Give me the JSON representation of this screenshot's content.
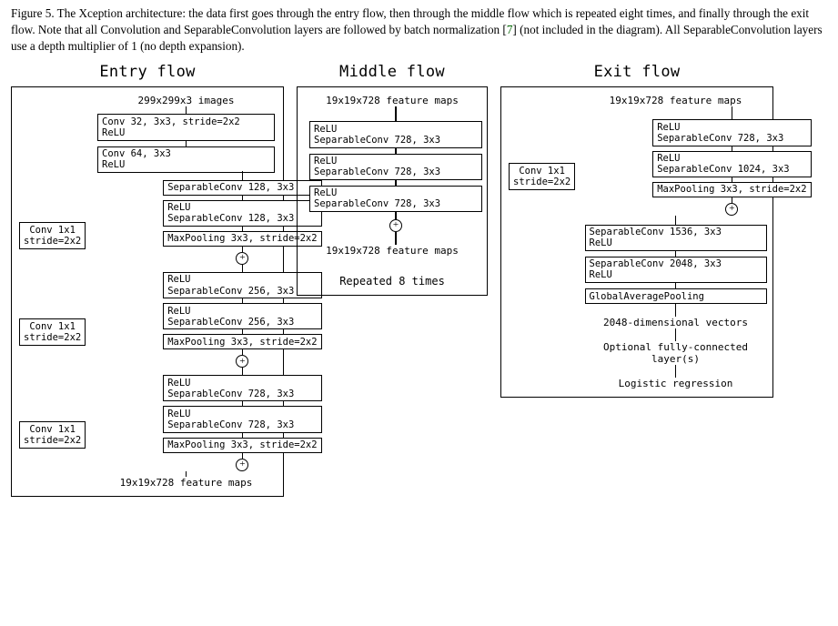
{
  "caption": {
    "prefix": "Figure 5. The Xception architecture: the data first goes through the entry flow, then through the middle flow which is repeated eight times, and finally through the exit flow. Note that all Convolution and SeparableConvolution layers are followed by batch normalization [",
    "cite": "7",
    "suffix": "] (not included in the diagram). All SeparableConvolution layers use a depth multiplier of 1 (no depth expansion)."
  },
  "entry": {
    "title": "Entry flow",
    "input": "299x299x3 images",
    "stem": [
      "Conv 32, 3x3, stride=2x2\nReLU",
      "Conv 64, 3x3\nReLU"
    ],
    "blocks": [
      {
        "side": "Conv 1x1\nstride=2x2",
        "layers": [
          "SeparableConv 128, 3x3",
          "ReLU\nSeparableConv 128, 3x3",
          "MaxPooling 3x3, stride=2x2"
        ]
      },
      {
        "side": "Conv 1x1\nstride=2x2",
        "layers": [
          "ReLU\nSeparableConv 256, 3x3",
          "ReLU\nSeparableConv 256, 3x3",
          "MaxPooling 3x3, stride=2x2"
        ]
      },
      {
        "side": "Conv 1x1\nstride=2x2",
        "layers": [
          "ReLU\nSeparableConv 728, 3x3",
          "ReLU\nSeparableConv 728, 3x3",
          "MaxPooling 3x3, stride=2x2"
        ]
      }
    ],
    "output": "19x19x728 feature maps"
  },
  "middle": {
    "title": "Middle flow",
    "input": "19x19x728 feature maps",
    "layers": [
      "ReLU\nSeparableConv 728, 3x3",
      "ReLU\nSeparableConv 728, 3x3",
      "ReLU\nSeparableConv 728, 3x3"
    ],
    "output": "19x19x728 feature maps",
    "note": "Repeated 8 times"
  },
  "exit": {
    "title": "Exit flow",
    "input": "19x19x728 feature maps",
    "block1": {
      "side": "Conv 1x1\nstride=2x2",
      "layers": [
        "ReLU\nSeparableConv 728, 3x3",
        "ReLU\nSeparableConv 1024, 3x3",
        "MaxPooling 3x3, stride=2x2"
      ]
    },
    "tail_layers": [
      "SeparableConv 1536, 3x3\nReLU",
      "SeparableConv 2048, 3x3\nReLU",
      "GlobalAveragePooling"
    ],
    "out1": "2048-dimensional vectors",
    "out2": "Optional fully-connected\nlayer(s)",
    "out3": "Logistic regression"
  }
}
